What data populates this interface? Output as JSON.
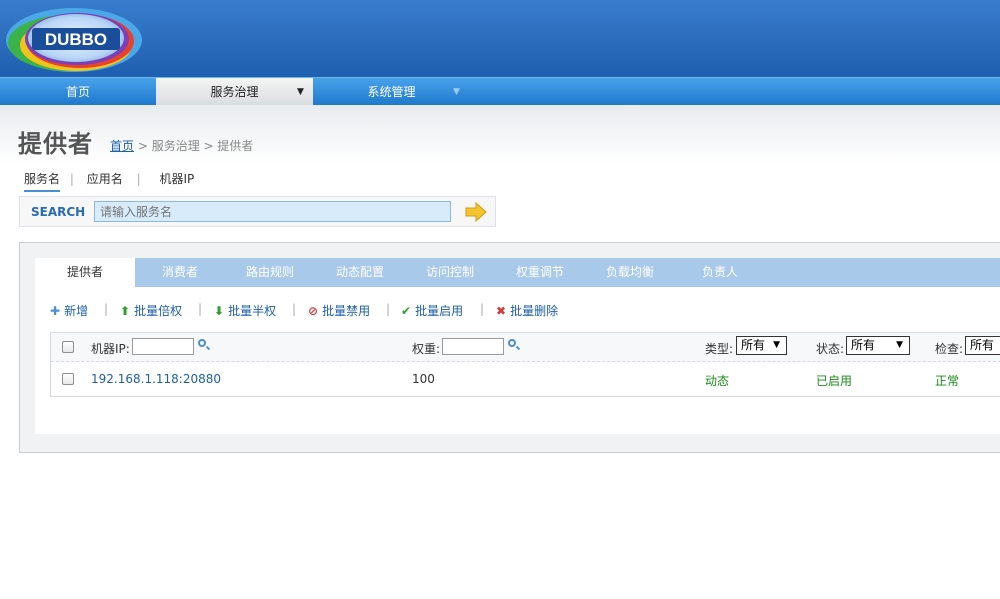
{
  "logo": {
    "text": "DUBBO"
  },
  "nav": {
    "items": [
      {
        "label": "首页"
      },
      {
        "label": "服务治理"
      },
      {
        "label": "系统管理"
      }
    ]
  },
  "page": {
    "title": "提供者",
    "breadcrumb": {
      "home": "首页",
      "sep1": " > ",
      "section": "服务治理",
      "sep2": " > ",
      "current": "提供者"
    }
  },
  "search": {
    "tabs": [
      {
        "label": "服务名"
      },
      {
        "label": "应用名"
      },
      {
        "label": "机器IP"
      }
    ],
    "tab_separator": "|",
    "label": "SEARCH",
    "placeholder": "请输入服务名",
    "value": ""
  },
  "tabs": [
    {
      "label": "提供者"
    },
    {
      "label": "消费者"
    },
    {
      "label": "路由规则"
    },
    {
      "label": "动态配置"
    },
    {
      "label": "访问控制"
    },
    {
      "label": "权重调节"
    },
    {
      "label": "负载均衡"
    },
    {
      "label": "负责人"
    }
  ],
  "toolbar": {
    "separator": "|",
    "items": [
      {
        "label": "新增",
        "icon": "plus-icon",
        "color": "#4a8fd6"
      },
      {
        "label": "批量倍权",
        "icon": "arrow-up-icon",
        "color": "#2e9e2e"
      },
      {
        "label": "批量半权",
        "icon": "arrow-down-icon",
        "color": "#2e9e2e"
      },
      {
        "label": "批量禁用",
        "icon": "forbidden-icon",
        "color": "#d23a3a"
      },
      {
        "label": "批量启用",
        "icon": "check-icon",
        "color": "#2e9e2e"
      },
      {
        "label": "批量删除",
        "icon": "delete-x-icon",
        "color": "#d23a3a"
      }
    ]
  },
  "grid": {
    "filters": {
      "ip_label": "机器IP:",
      "weight_label": "权重:",
      "type_label": "类型:",
      "type_value": "所有",
      "status_label": "状态:",
      "status_value": "所有",
      "check_label": "检查:",
      "check_value": "所有"
    },
    "rows": [
      {
        "address": "192.168.1.118:20880",
        "weight": "100",
        "type": "动态",
        "status": "已启用",
        "check": "正常"
      }
    ]
  },
  "colors": {
    "header": "#2566b8",
    "nav": "#2d88d8",
    "tab_bar": "#a9c9ea",
    "link": "#1d5fa8",
    "status_green": "#1a8a1a"
  }
}
